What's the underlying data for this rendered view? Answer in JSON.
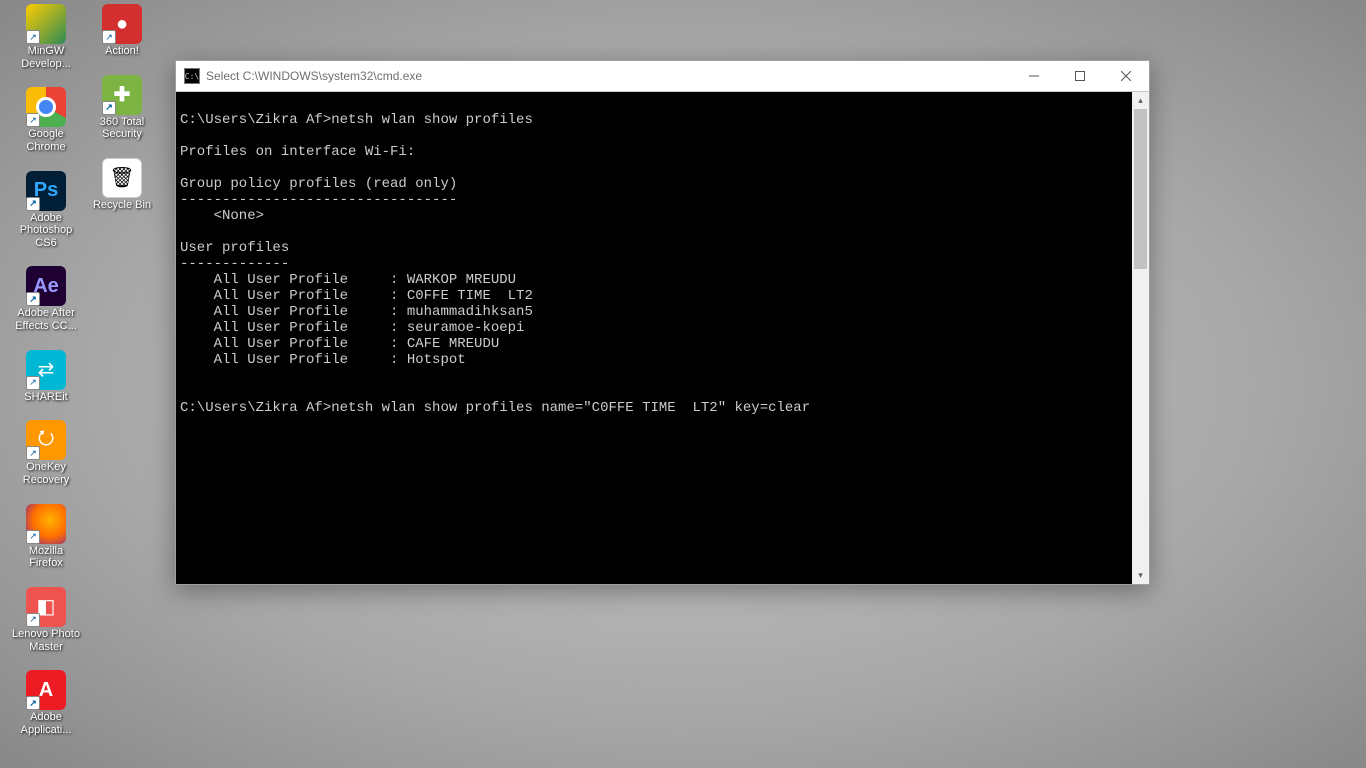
{
  "desktop": {
    "col1": [
      {
        "name": "mingw",
        "label": "MinGW Develop..."
      },
      {
        "name": "chrome",
        "label": "Google Chrome"
      },
      {
        "name": "photoshop",
        "label": "Adobe Photoshop CS6"
      },
      {
        "name": "aftereffects",
        "label": "Adobe After Effects CC..."
      },
      {
        "name": "shareit",
        "label": "SHAREit"
      },
      {
        "name": "onekey",
        "label": "OneKey Recovery"
      },
      {
        "name": "firefox",
        "label": "Mozilla Firefox"
      },
      {
        "name": "lenovo",
        "label": "Lenovo Photo Master"
      },
      {
        "name": "adobeapp",
        "label": "Adobe Applicati..."
      }
    ],
    "col2": [
      {
        "name": "action",
        "label": "Action!"
      },
      {
        "name": "360",
        "label": "360 Total Security"
      },
      {
        "name": "recycle",
        "label": "Recycle Bin"
      }
    ]
  },
  "window": {
    "title": "Select C:\\WINDOWS\\system32\\cmd.exe",
    "icon_text": "C:\\"
  },
  "terminal": {
    "lines": [
      "",
      "C:\\Users\\Zikra Af>netsh wlan show profiles",
      "",
      "Profiles on interface Wi-Fi:",
      "",
      "Group policy profiles (read only)",
      "---------------------------------",
      "    <None>",
      "",
      "User profiles",
      "-------------",
      "    All User Profile     : WARKOP MREUDU",
      "    All User Profile     : C0FFE TIME  LT2",
      "    All User Profile     : muhammadihksan5",
      "    All User Profile     : seuramoe-koepi",
      "    All User Profile     : CAFE MREUDU",
      "    All User Profile     : Hotspot",
      "",
      "",
      "C:\\Users\\Zikra Af>netsh wlan show profiles name=\"C0FFE TIME  LT2\" key=clear",
      ""
    ]
  }
}
